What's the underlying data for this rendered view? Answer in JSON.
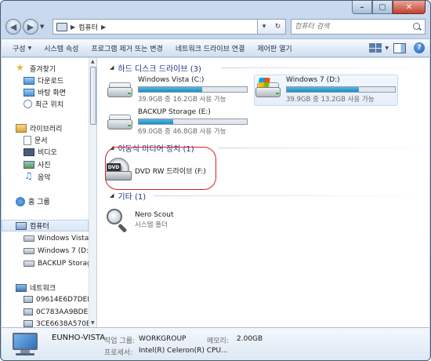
{
  "window": {
    "caption_buttons": [
      "minimize",
      "maximize",
      "close"
    ]
  },
  "address_bar": {
    "path": [
      "컴퓨터"
    ],
    "search_placeholder": "컴퓨터 검색"
  },
  "toolbar": {
    "items": [
      {
        "label": "구성",
        "has_dropdown": true
      },
      {
        "label": "시스템 속성"
      },
      {
        "label": "프로그램 제거 또는 변경"
      },
      {
        "label": "네트워크 드라이브 연결"
      },
      {
        "label": "제어판 열기"
      }
    ],
    "help_label": "?"
  },
  "nav_pane": {
    "favorites": {
      "label": "즐겨찾기",
      "items": [
        "다운로드",
        "바탕 화면",
        "최근 위치"
      ]
    },
    "libraries": {
      "label": "라이브러리",
      "items": [
        "문서",
        "비디오",
        "사진",
        "음악"
      ]
    },
    "homegroup": {
      "label": "홈 그룹"
    },
    "computer": {
      "label": "컴퓨터",
      "items": [
        "Windows Vista (C",
        "Windows 7 (D:)",
        "BACKUP Storage"
      ]
    },
    "network": {
      "label": "네트워크",
      "items": [
        "09614E6D7DEF4",
        "0C783AA9BDE8",
        "3CE6638A570B4"
      ]
    }
  },
  "content": {
    "groups": [
      {
        "title": "하드 디스크 드라이브 (3)"
      },
      {
        "title": "이동식 미디어 장치 (1)"
      },
      {
        "title": "기타 (1)"
      }
    ],
    "drives": [
      {
        "name": "Windows Vista (C:)",
        "size_text": "39.9GB 중 16.2GB 사용 가능",
        "used_fraction": 0.59
      },
      {
        "name": "Windows 7 (D:)",
        "size_text": "39.9GB 중 13.2GB 사용 가능",
        "used_fraction": 0.67
      },
      {
        "name": "BACKUP Storage (E:)",
        "size_text": "69.0GB 중 46.8GB 사용 가능",
        "used_fraction": 0.32
      }
    ],
    "removable": {
      "name": "DVD RW 드라이브 (F:)",
      "icon_label": "DVD"
    },
    "other": {
      "name": "Nero Scout",
      "type": "시스템 폴더"
    }
  },
  "details": {
    "computer_name": "EUNHO-VISTA",
    "workgroup_label": "작업 그룹:",
    "workgroup_value": "WORKGROUP",
    "memory_label": "메모리:",
    "memory_value": "2.00GB",
    "processor_label": "프로세서:",
    "processor_value": "Intel(R) Celeron(R) CPU..."
  },
  "colors": {
    "accent": "#1f89c6",
    "group_header": "#1e3287",
    "highlight_oval": "#d0202a"
  }
}
